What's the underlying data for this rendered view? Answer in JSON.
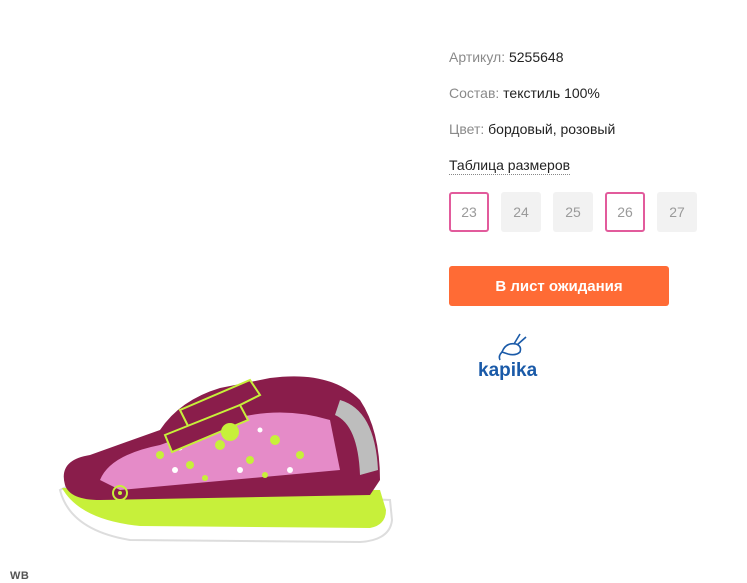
{
  "product": {
    "article_label": "Артикул:",
    "article_value": "5255648",
    "composition_label": "Состав:",
    "composition_value": "текстиль 100%",
    "color_label": "Цвет:",
    "color_value": "бордовый, розовый",
    "size_table_link": "Таблица размеров"
  },
  "sizes": [
    {
      "label": "23",
      "selected": true
    },
    {
      "label": "24",
      "selected": false
    },
    {
      "label": "25",
      "selected": false
    },
    {
      "label": "26",
      "selected": true
    },
    {
      "label": "27",
      "selected": false
    }
  ],
  "actions": {
    "waitlist_label": "В лист ожидания"
  },
  "brand": {
    "logo_text": "kapika",
    "icon": "rabbit-icon"
  },
  "watermark": "WB",
  "colors": {
    "accent": "#ff6b35",
    "selected_border": "#e25b9c",
    "brand_blue": "#1a5aa8"
  }
}
